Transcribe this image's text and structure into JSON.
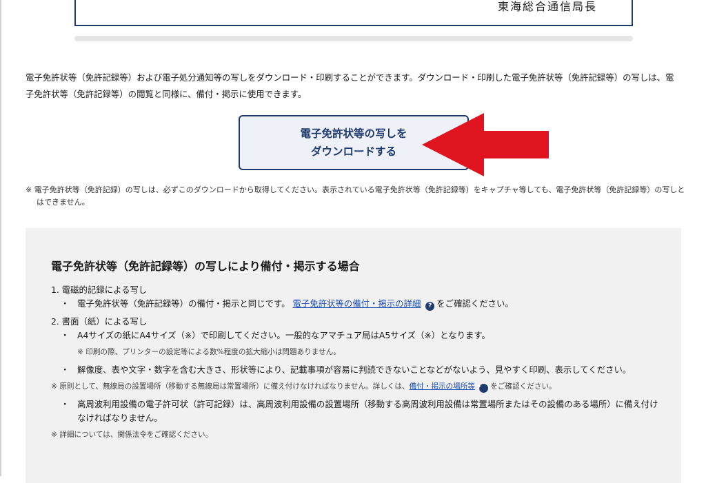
{
  "certificate": {
    "signer": "東海総合通信局長"
  },
  "intro": {
    "text": "電子免許状等（免許記録等）および電子処分通知等の写しをダウンロード・印刷することができます。ダウンロード・印刷した電子免許状等（免許記録等）の写しは、電子免許状等（免許記録等）の閲覧と同様に、備付・掲示に使用できます。"
  },
  "download_button": {
    "line1": "電子免許状等の写しを",
    "line2": "ダウンロードする"
  },
  "colors": {
    "accent": "#1f3a6e",
    "link": "#1f4fb5",
    "arrow": "#e0141e",
    "panel_bg": "#f1f1f2"
  },
  "note_top": "※ 電子免許状等（免許記録）の写しは、必ずこのダウンロードから取得してください。表示されている電子免許状等（免許記録等）をキャプチャ等しても、電子免許状等（免許記録等）の写しとはできません。",
  "panel": {
    "heading": "電子免許状等（免許記録等）の写しにより備付・掲示する場合",
    "section1": {
      "title": "1. 電磁的記録による写し",
      "bullet_prefix": "電子免許状等（免許記録等）の備付・掲示と同じです。",
      "link": "電子免許状等の備付・掲示の詳細",
      "help_icon": "question-circle-icon",
      "bullet_suffix": "をご確認ください。"
    },
    "section2": {
      "title": "2. 書面（紙）による写し",
      "bullet1": "A4サイズの紙にA4サイズ（※）で印刷してください。一般的なアマチュア局はA5サイズ（※）となります。",
      "subnote": "※ 印刷の際、プリンターの設定等による数%程度の拡大縮小は問題ありません。",
      "bullet2": "解像度、表や文字・数字を含む大きさ、形状等により、記載事項が容易に判読できないことなどがないよう、見やすく印刷、表示してください。",
      "note_prefix": "※ 原則として、無線局の設置場所（移動する無線局は常置場所）に備え付けなければなりません。詳しくは、",
      "note_link": "備付・掲示の場所等",
      "note_suffix": "をご確認ください。",
      "bullet3": "高周波利用設備の電子許可状（許可記録）は、高周波利用設備の設置場所（移動する高周波利用設備は常置場所またはその設備のある場所）に備え付けなければなりません。"
    },
    "bottom_note": "※ 詳細については、関係法令をご確認ください。"
  }
}
